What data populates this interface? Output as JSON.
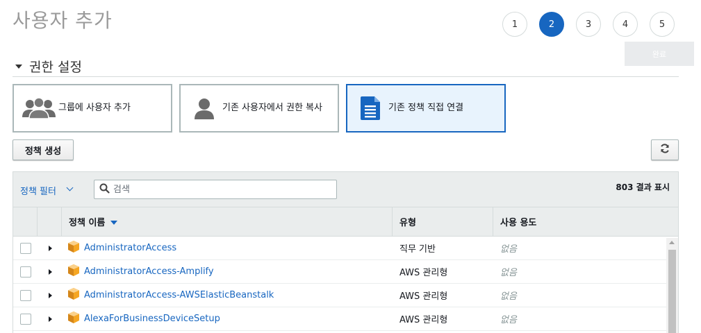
{
  "page": {
    "title": "사용자 추가"
  },
  "steps": [
    {
      "label": "1",
      "active": false
    },
    {
      "label": "2",
      "active": true
    },
    {
      "label": "3",
      "active": false
    },
    {
      "label": "4",
      "active": false
    },
    {
      "label": "5",
      "active": false
    }
  ],
  "tooltip": {
    "text": "완료"
  },
  "section": {
    "title": "권한 설정"
  },
  "options": [
    {
      "label": "그룹에 사용자 추가",
      "icon": "users-group-icon",
      "selected": false
    },
    {
      "label": "기존 사용자에서 권한 복사",
      "icon": "user-icon",
      "selected": false
    },
    {
      "label": "기존 정책 직접 연결",
      "icon": "document-icon",
      "selected": true
    }
  ],
  "toolbar": {
    "create_policy_label": "정책 생성",
    "refresh_icon": "refresh-icon"
  },
  "filter": {
    "label": "정책 필터",
    "search_placeholder": "검색",
    "result_count": "803 결과 표시"
  },
  "table": {
    "headers": {
      "name": "정책 이름",
      "type": "유형",
      "usage": "사용 용도"
    },
    "rows": [
      {
        "name": "AdministratorAccess",
        "type": "직무 기반",
        "usage": "없음"
      },
      {
        "name": "AdministratorAccess-Amplify",
        "type": "AWS 관리형",
        "usage": "없음"
      },
      {
        "name": "AdministratorAccess-AWSElasticBeanstalk",
        "type": "AWS 관리형",
        "usage": "없음"
      },
      {
        "name": "AlexaForBusinessDeviceSetup",
        "type": "AWS 관리형",
        "usage": "없음"
      }
    ]
  },
  "colors": {
    "accent": "#1766c0",
    "policy_icon": "#f5a623",
    "muted": "#879596"
  }
}
